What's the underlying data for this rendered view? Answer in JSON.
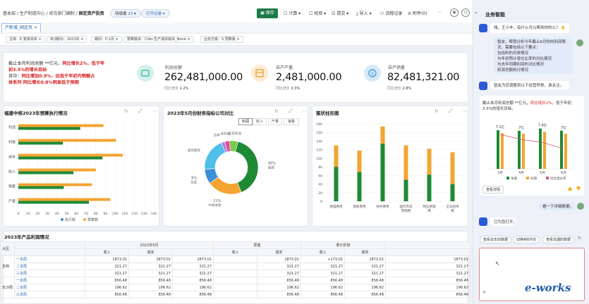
{
  "header": {
    "crumbs": [
      "基本部",
      "生产制造中心",
      "综合部门编制"
    ],
    "current": "固定资产投资",
    "badge_label": "待填报",
    "badge_count": "23",
    "record_label": "打开记录",
    "save_label": "保存",
    "tools": [
      "计算",
      "校验",
      "提交",
      "导入",
      "流程记录",
      "附件(0)"
    ]
  },
  "tab": {
    "label": "产新增_固定页",
    "close": "×"
  },
  "filters": [
    "主体：E 复保本体",
    "年(期间)：2023年",
    "期间：P-1月",
    "预算版本：CVer:生产成本版本_None",
    "业务方案：S 预算版"
  ],
  "note": {
    "line1a": "截止本月利润总额 **亿元，",
    "line1b": "同比增长2%，低于年",
    "line2": "初3.5%的增长目标",
    "line3a": "其中：",
    "line3b": "同比增加0.9%，远低于年初内销额占",
    "line4": "体系列 同比增长0.8%明显低于预期"
  },
  "kpis": [
    {
      "label": "利润总额",
      "value": "262,481,000.00",
      "sub_label": "同比增长",
      "sub_value": "1.2%"
    },
    {
      "label": "自产产量",
      "value": "2,481,000.00",
      "sub_label": "同比增长",
      "sub_value": "0.3%"
    },
    {
      "label": "自产销量",
      "value": "82,481,321.00",
      "sub_label": "同比增长",
      "sub_value": "2.8%"
    }
  ],
  "panel_icons": "↻ ⤢ ⋯",
  "chart1": {
    "title": "福建中核2023年预算执行情况",
    "categories": [
      "利润",
      "利税",
      "成本",
      "收入",
      "销量",
      "产量"
    ],
    "series_names": [
      "执行数",
      "预算数"
    ],
    "exec": [
      64,
      46,
      87,
      57,
      47,
      73
    ],
    "budget": [
      88,
      101,
      108,
      80,
      76,
      95
    ],
    "ticks": [
      "0",
      "10",
      "20",
      "30",
      "40",
      "50",
      "60",
      "70",
      "80",
      "90",
      "100",
      "110",
      "120",
      "130",
      "140"
    ],
    "xmax": 140
  },
  "chart2": {
    "title": "2023年5月份财务指标公司对比",
    "seg": [
      "利润",
      "收入",
      "产量",
      "销量"
    ],
    "slices": [
      {
        "name": "福建",
        "pct": 40,
        "label": "40%",
        "color": "#1f8a36"
      },
      {
        "name": "中核本部",
        "pct": 21,
        "label": "21%",
        "color": "#f3a432"
      },
      {
        "name": "龙岩",
        "pct": 9,
        "label": "9%",
        "color": "#3c8fd8"
      },
      {
        "name": "盛圳复核",
        "pct": 20,
        "label": "",
        "color": "#4fc0e8"
      },
      {
        "name": "吉林",
        "pct": 2,
        "label": "",
        "color": "#b07cd6"
      },
      {
        "name": "新轮胎",
        "pct": 3,
        "label": "",
        "color": "#e04fa0"
      },
      {
        "name": "红塔英油",
        "pct": 5,
        "label": "",
        "color": "#7cc94d"
      }
    ]
  },
  "chart3": {
    "title": "簇状柱形图",
    "categories": [
      "管理费用",
      "销售费用",
      "财务费用",
      "国内市场营销费",
      "物业管理费",
      "全员招待费"
    ],
    "a": [
      80,
      68,
      134,
      50,
      62,
      40
    ],
    "b": [
      50,
      50,
      40,
      80,
      60,
      74
    ],
    "yticks": [
      0,
      20,
      40,
      60,
      80,
      100,
      120,
      140,
      160,
      180
    ],
    "ymax": 180
  },
  "table": {
    "title": "2023年产品利润情况",
    "dim": "大区",
    "groups": [
      "2022年5月",
      "原值",
      "累计折旧"
    ],
    "subs": [
      "收入",
      "成本"
    ],
    "regions": [
      "吉林",
      "长沙局"
    ],
    "rows": [
      [
        "一本局",
        "1873.01",
        "1873.01",
        "1873.01",
        "1873.01",
        "+173.01",
        "1873.01",
        "1873.01",
        "1873.01"
      ],
      [
        "二本局",
        "321.27",
        "321.27",
        "321.27",
        "321.27",
        "321.27",
        "321.27",
        "321.27",
        "321.27"
      ],
      [
        "三本局",
        "321.27",
        "321.27",
        "321.27",
        "321.27",
        "321.27",
        "321.27",
        "321.27",
        "321.27"
      ],
      [
        "一本局",
        "856.48",
        "856.48",
        "856.48",
        "856.48",
        "856.48",
        "856.48",
        "856.48",
        "856.48"
      ],
      [
        "二本局",
        "196.62",
        "196.62",
        "196.62",
        "196.62",
        "196.62",
        "196.62",
        "196.62",
        "196.62"
      ],
      [
        "三本局",
        "856.48",
        "856.48",
        "856.48",
        "856.48",
        "856.48",
        "856.48",
        "856.48",
        "856.48"
      ]
    ]
  },
  "assistant": {
    "title": "业务智能",
    "greet": "嗨，王小丰，有什么可以帮到你的么？",
    "req": [
      "智友，帮我分析今年截止6月份的利润情况，需要包括以下要点：",
      "包括利的总体情况",
      "与年初预计增长比率的对比情况",
      "与去年同期利润的对比情况",
      "利润总额执行情况"
    ],
    "ack": "智友为您调整到以下经营异常，请关注。",
    "reply_a": "截止本月利润总额 **亿元，",
    "reply_b": "同比增长2%",
    "reply_c": "，低于年初3.5%的增长目标。",
    "mini_cats": [
      "3月",
      "4月",
      "5月",
      "6月"
    ],
    "mini_labels": [
      "7.1亿",
      "7亿",
      "7.4亿",
      "7亿"
    ],
    "mini_legend": [
      "本期",
      "同期",
      "同比增长率"
    ],
    "detail": "查看详情",
    "user_msg": "看一下详细数据。",
    "open_msg": "已为您打开。",
    "suggestions": [
      "查看去年的数据",
      "切换到8月份",
      "查看龙烟的数据"
    ],
    "watermark": "e-works"
  }
}
